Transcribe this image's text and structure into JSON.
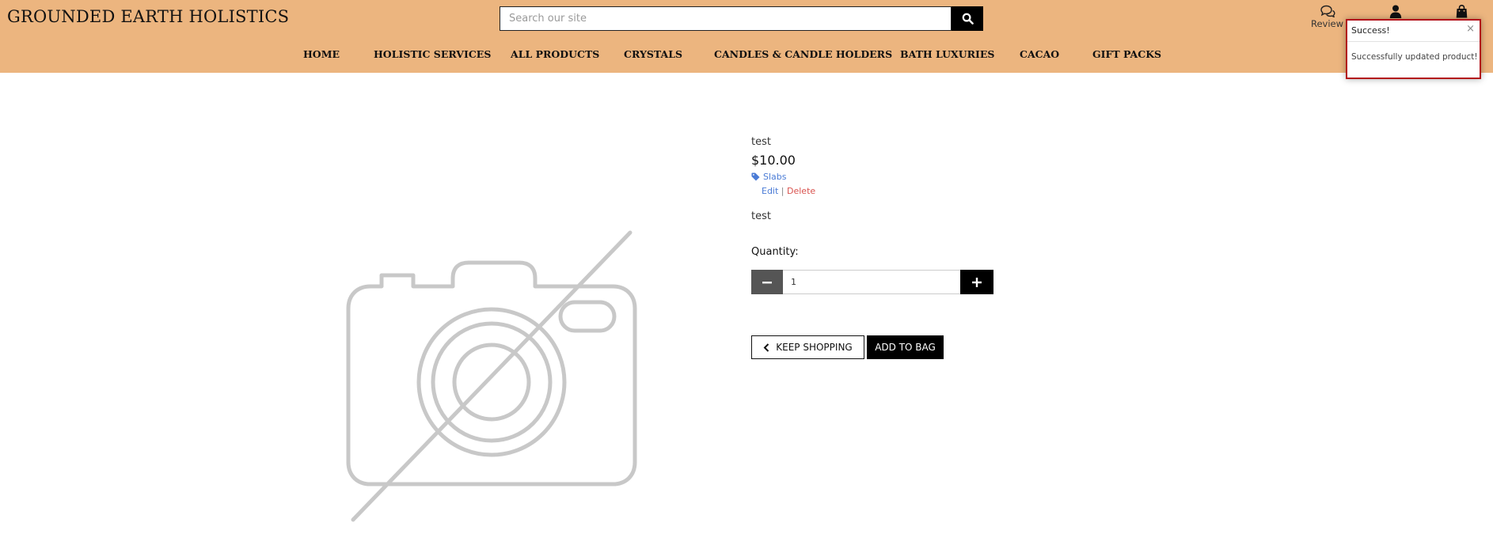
{
  "header": {
    "brand": "GROUNDED EARTH HOLISTICS",
    "search": {
      "placeholder": "Search our site",
      "value": ""
    },
    "icons": {
      "review_label": "Review"
    }
  },
  "nav": {
    "items": [
      "HOME",
      "HOLISTIC SERVICES",
      "ALL PRODUCTS",
      "CRYSTALS",
      "CANDLES & CANDLE HOLDERS",
      "BATH LUXURIES",
      "CACAO",
      "GIFT PACKS"
    ]
  },
  "toast": {
    "title": "Success!",
    "close": "×",
    "message": "Successfully updated product!"
  },
  "product": {
    "name": "test",
    "price": "$10.00",
    "category": "Slabs",
    "edit_label": "Edit",
    "separator": " | ",
    "delete_label": "Delete",
    "description": "test",
    "quantity_label": "Quantity:",
    "quantity_value": "1",
    "keep_shopping_label": "KEEP SHOPPING",
    "add_to_bag_label": "ADD TO BAG",
    "image_icon": "no-image-camera-icon"
  },
  "colors": {
    "header_bg": "#ecb57f",
    "toast_border": "#b3121b",
    "link_blue": "#4a7bd6",
    "delete_red": "#d9534f"
  }
}
